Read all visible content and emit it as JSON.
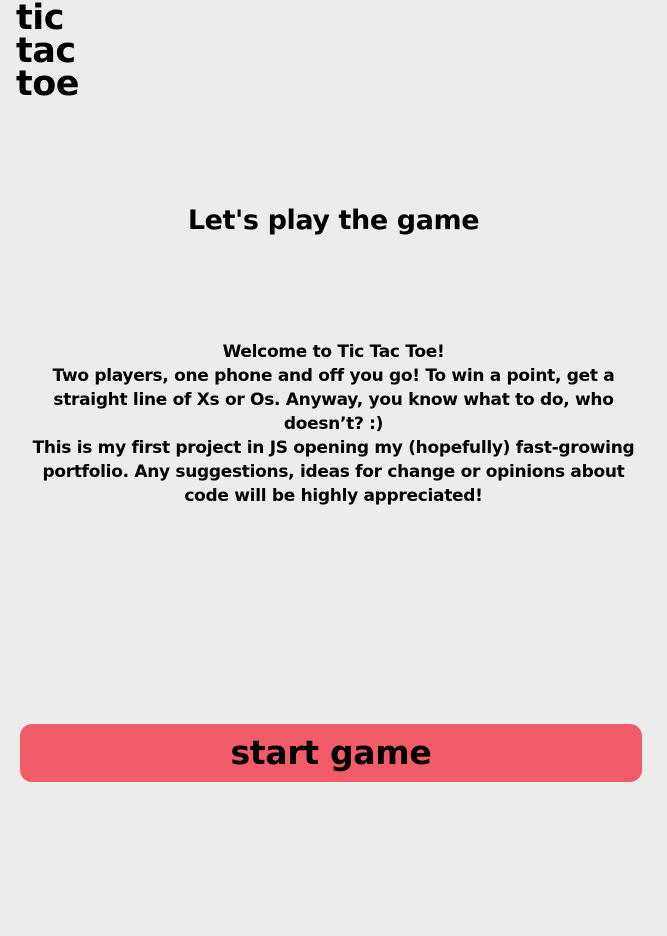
{
  "logo": {
    "line1": "tic",
    "line2": "tac",
    "line3": "toe"
  },
  "title": "Let's play the game",
  "intro": {
    "welcome": "Welcome to Tic Tac Toe!",
    "paragraph1": "Two players, one phone and off you go! To win a point, get a straight line of Xs or Os. Anyway, you know what to do, who doesn’t? :)",
    "paragraph2": "This is my first project in JS opening my (hopefully) fast-growing portfolio. Any suggestions, ideas for change or opinions about code will be highly appreciated!"
  },
  "start_button": {
    "label": "start game"
  },
  "colors": {
    "background": "#ececec",
    "button": "#f25c69",
    "text": "#000000"
  }
}
